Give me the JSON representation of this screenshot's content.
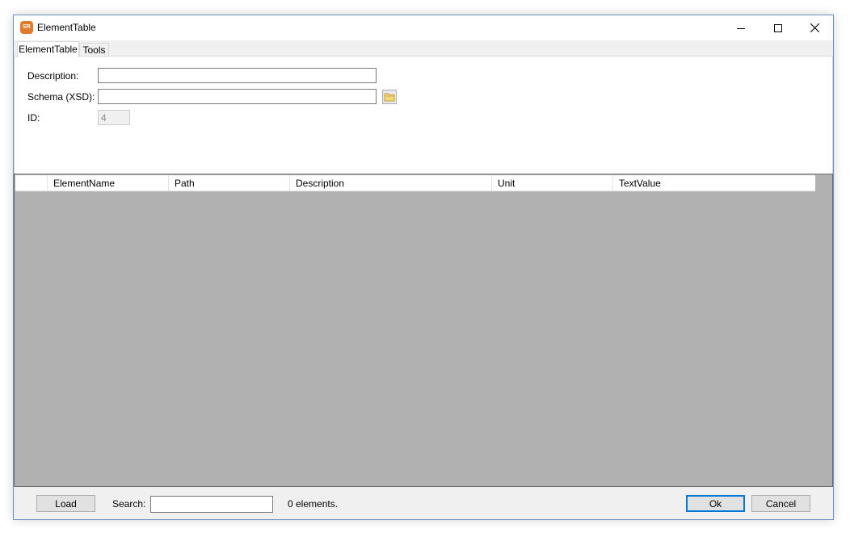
{
  "window": {
    "title": "ElementTable",
    "app_icon_text": "SR",
    "controls": [
      "minimize-icon",
      "maximize-icon",
      "close-icon"
    ]
  },
  "tabs": [
    {
      "label": "ElementTable",
      "active": true
    },
    {
      "label": "Tools",
      "active": false
    }
  ],
  "form": {
    "description_label": "Description:",
    "description_value": "",
    "schema_label": "Schema (XSD):",
    "schema_value": "",
    "browse_icon": "folder-icon",
    "id_label": "ID:",
    "id_value": "4"
  },
  "grid": {
    "columns": [
      "ElementName",
      "Path",
      "Description",
      "Unit",
      "TextValue"
    ],
    "rows": []
  },
  "footer": {
    "load_label": "Load",
    "search_label": "Search:",
    "search_value": "",
    "count_text": "0 elements.",
    "ok_label": "Ok",
    "cancel_label": "Cancel"
  },
  "colors": {
    "window_border": "#6b8fbf",
    "grid_background": "#b1b1b1",
    "default_button_accent": "#0078d7",
    "app_icon": "#e07a2c"
  }
}
